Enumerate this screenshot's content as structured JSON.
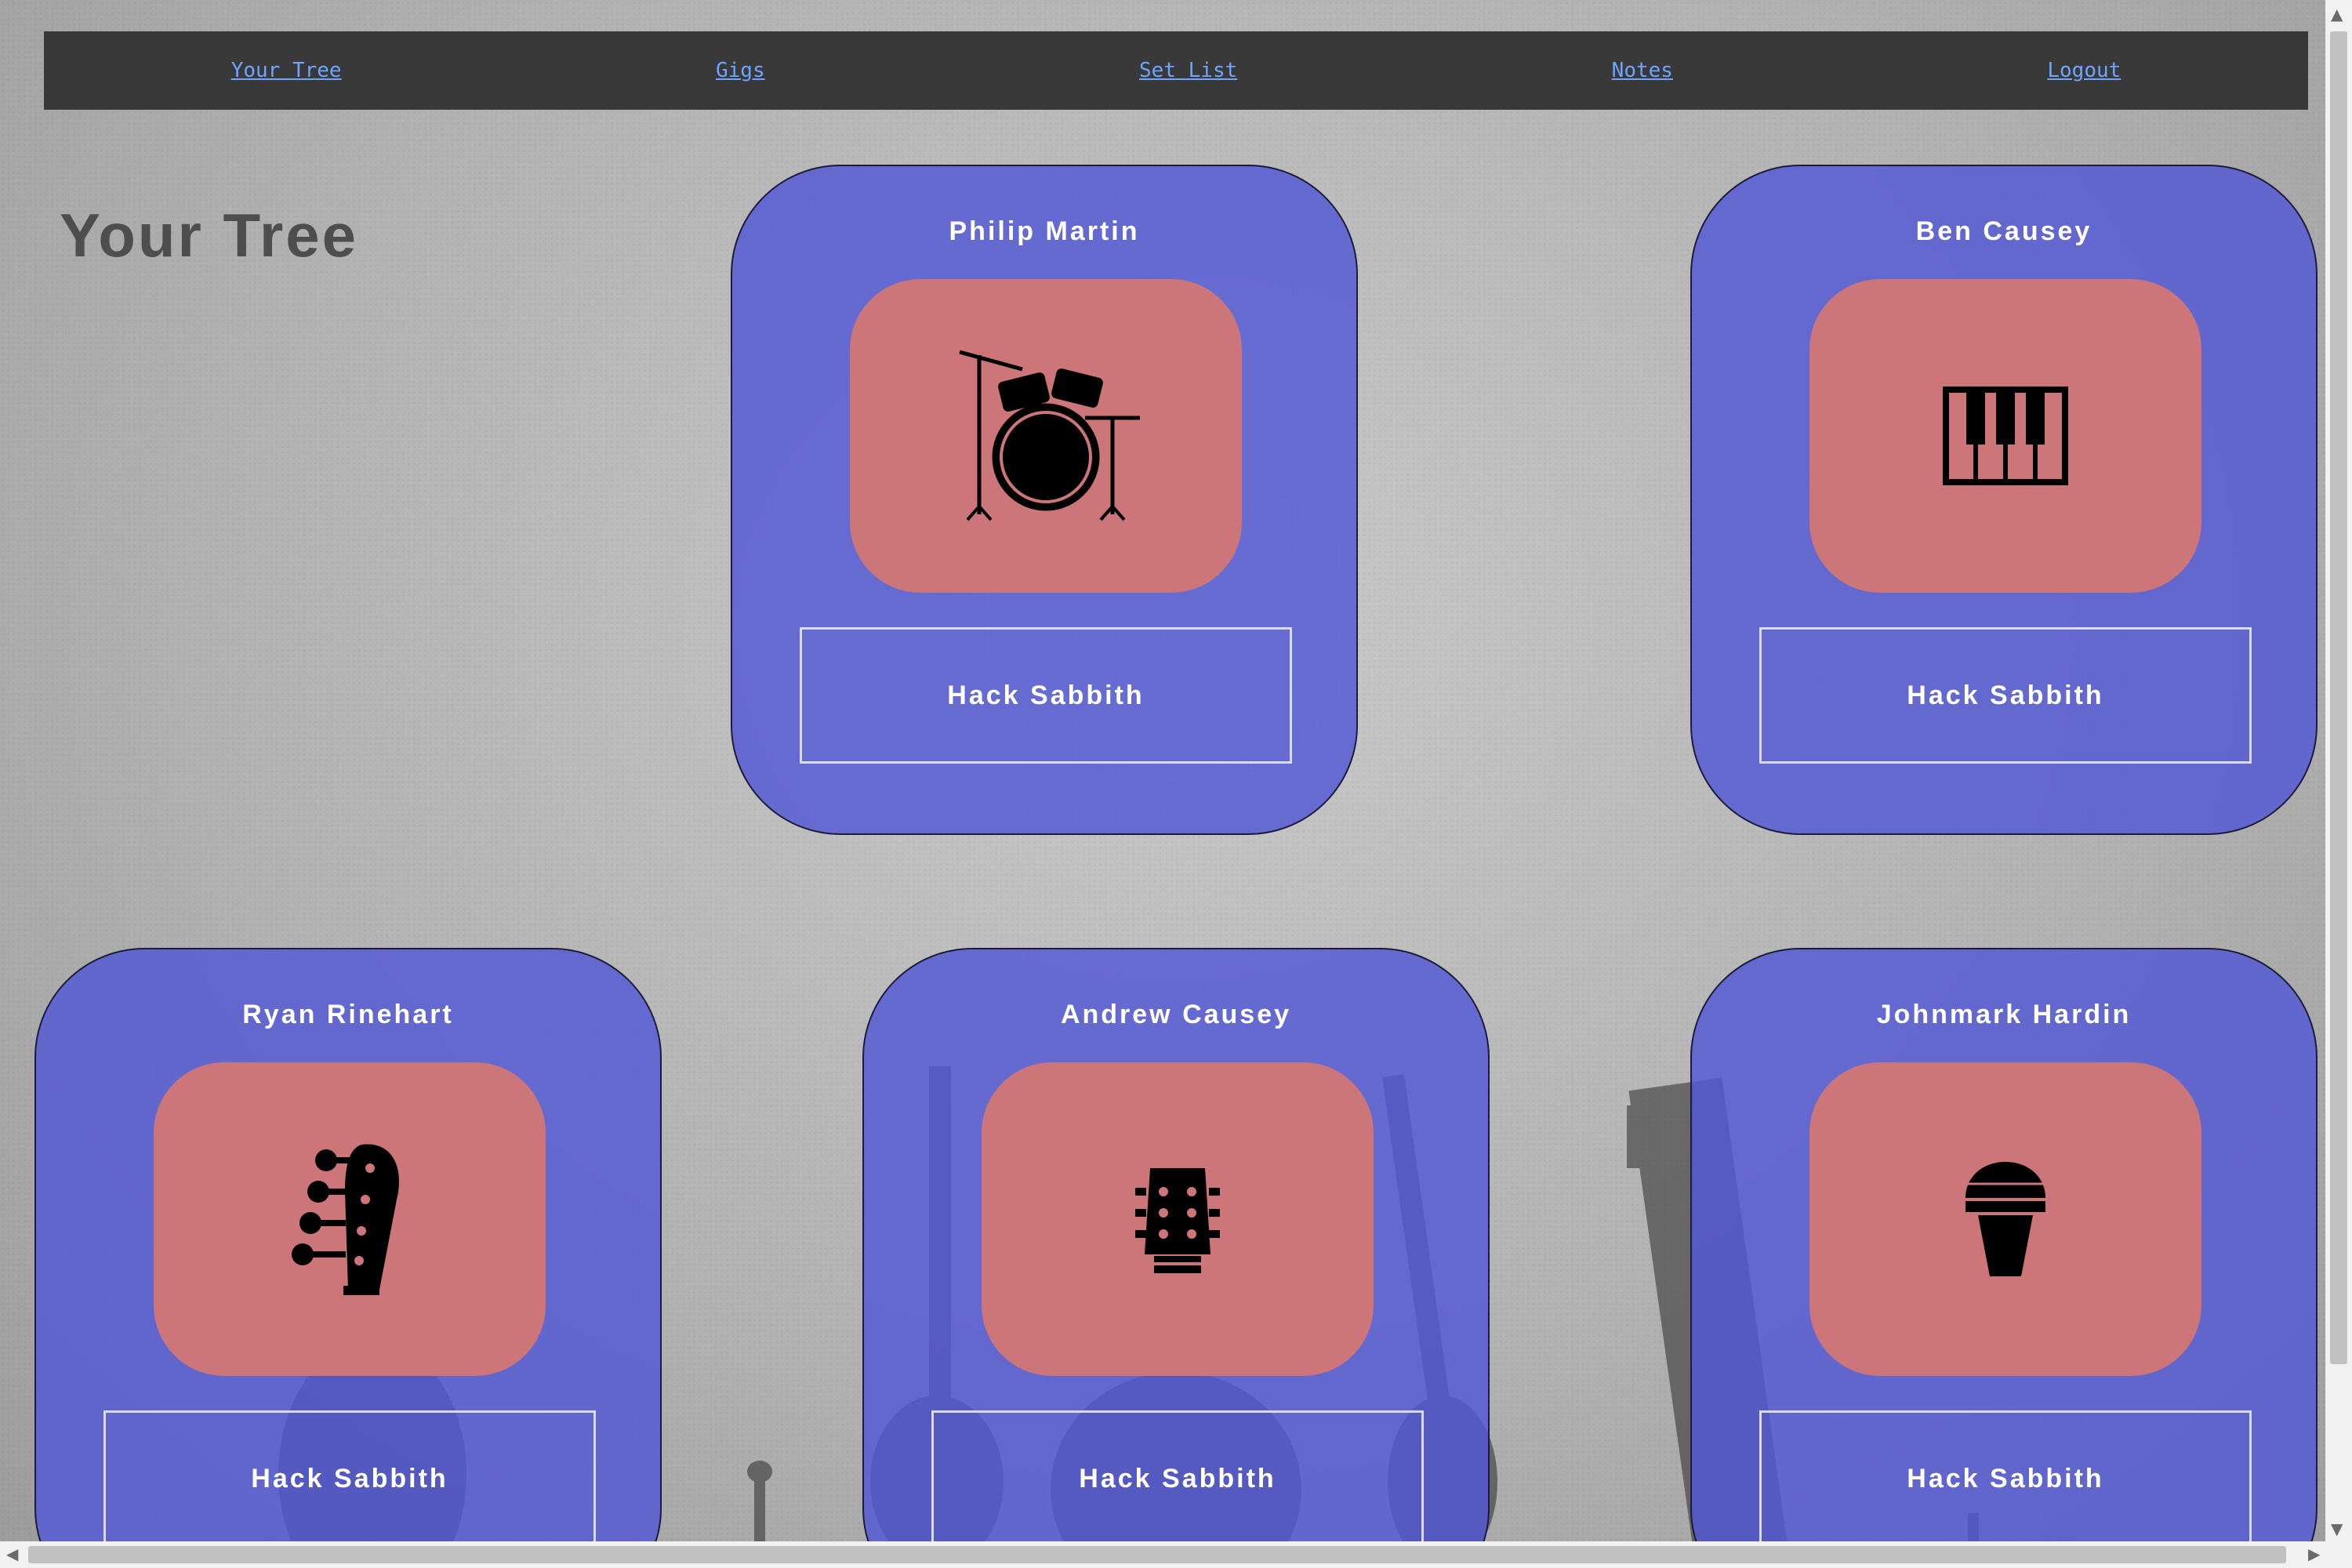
{
  "nav": {
    "items": [
      {
        "label": "Your Tree"
      },
      {
        "label": "Gigs"
      },
      {
        "label": "Set List"
      },
      {
        "label": "Notes"
      },
      {
        "label": "Logout"
      }
    ]
  },
  "page": {
    "title": "Your Tree"
  },
  "members": [
    {
      "name": "Philip Martin",
      "instrument_icon": "drum-kit-icon",
      "band": "Hack Sabbith"
    },
    {
      "name": "Ben Causey",
      "instrument_icon": "piano-keys-icon",
      "band": "Hack Sabbith"
    },
    {
      "name": "Ryan Rinehart",
      "instrument_icon": "bass-headstock-icon",
      "band": "Hack Sabbith"
    },
    {
      "name": "Andrew Causey",
      "instrument_icon": "guitar-headstock-icon",
      "band": "Hack Sabbith"
    },
    {
      "name": "Johnmark Hardin",
      "instrument_icon": "microphone-icon",
      "band": "Hack Sabbith"
    }
  ],
  "colors": {
    "card": "#5258d6",
    "icon_tile": "#cd7679",
    "nav_bg": "#393939",
    "nav_link": "#6fa4ff"
  }
}
